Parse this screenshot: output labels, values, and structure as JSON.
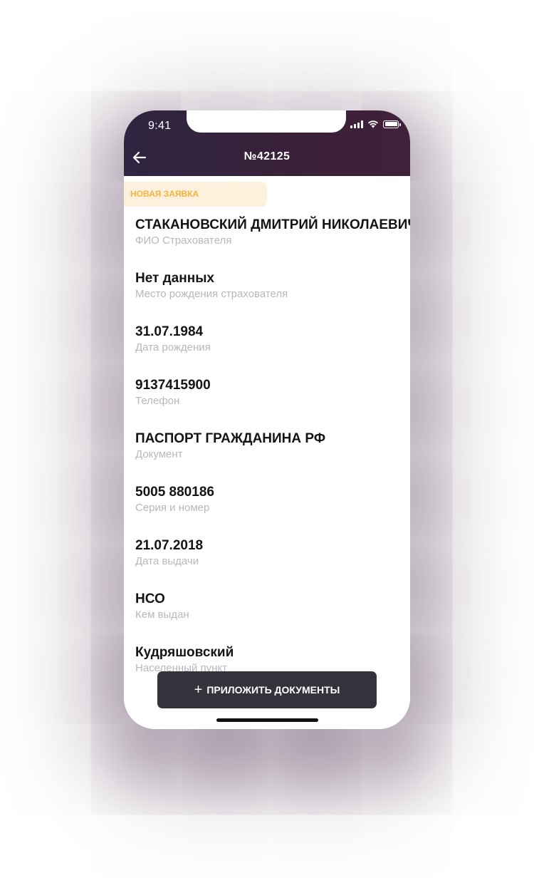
{
  "status_bar": {
    "time": "9:41"
  },
  "header": {
    "title": "№42125",
    "back_icon": "arrow-left-icon"
  },
  "status_badge": {
    "label": "НОВАЯ ЗАЯВКА",
    "text_color": "#f3b441",
    "bg_color": "#fdf0dc"
  },
  "fields": [
    {
      "value": "СТАКАНОВСКИЙ ДМИТРИЙ НИКОЛАЕВИЧ",
      "label": "ФИО Страхователя"
    },
    {
      "value": "Нет данных",
      "label": "Место рождения страхователя"
    },
    {
      "value": "31.07.1984",
      "label": "Дата рождения"
    },
    {
      "value": "9137415900",
      "label": "Телефон"
    },
    {
      "value": "ПАСПОРТ ГРАЖДАНИНА РФ",
      "label": "Документ"
    },
    {
      "value": "5005 880186",
      "label": "Серия и номер"
    },
    {
      "value": "21.07.2018",
      "label": "Дата выдачи"
    },
    {
      "value": "НСО",
      "label": "Кем выдан"
    },
    {
      "value": "Кудряшовский",
      "label": "Населенный пункт"
    }
  ],
  "attach_button": {
    "icon": "plus-icon",
    "label": "ПРИЛОЖИТЬ ДОКУМЕНТЫ"
  },
  "colors": {
    "header_start": "#2e2540",
    "header_end": "#41203a",
    "button_bg": "#34323a"
  }
}
